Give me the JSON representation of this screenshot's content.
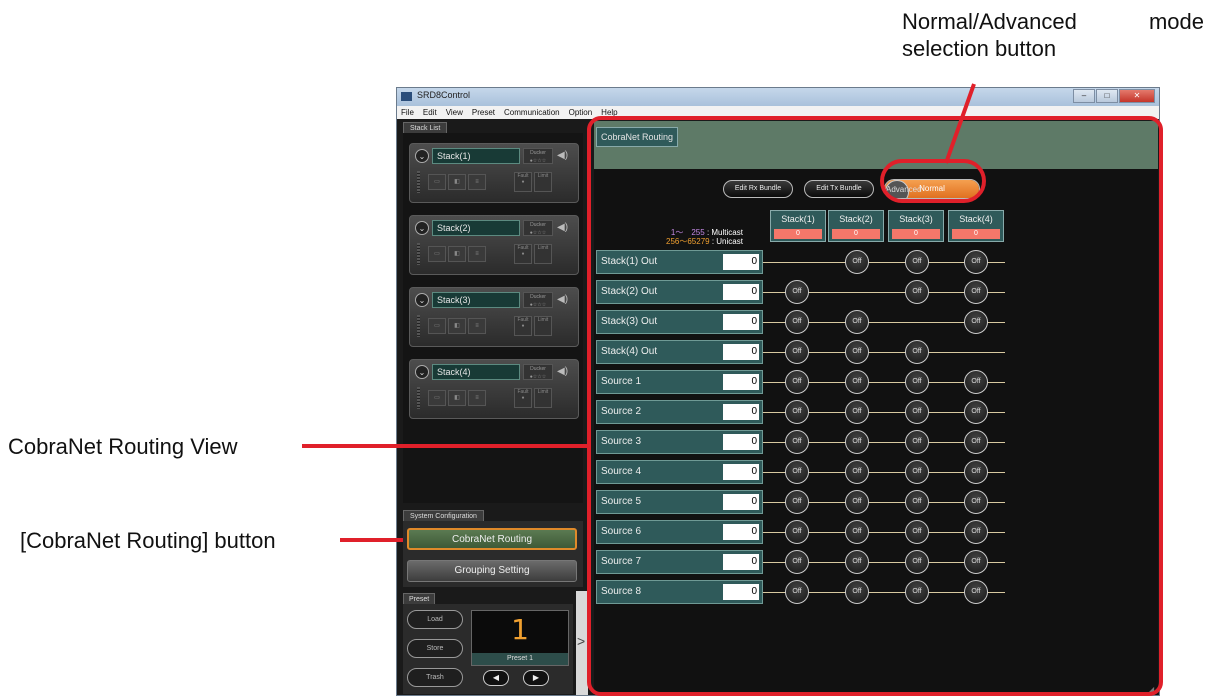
{
  "annotations": {
    "mode_button": [
      "Normal/Advanced mode",
      "selection button"
    ],
    "routing_view": "CobraNet Routing View",
    "routing_button": "[CobraNet Routing] button",
    "accent_color": "#e0202a"
  },
  "window": {
    "title": "SRD8Control",
    "menu": [
      "File",
      "Edit",
      "View",
      "Preset",
      "Communication",
      "Option",
      "Help"
    ]
  },
  "stack_list": {
    "tab": "Stack List",
    "stacks": [
      {
        "name": "Stack(1)",
        "ducker": "Ducker",
        "fault": "Fault",
        "limit": "Limit"
      },
      {
        "name": "Stack(2)",
        "ducker": "Ducker",
        "fault": "Fault",
        "limit": "Limit"
      },
      {
        "name": "Stack(3)",
        "ducker": "Ducker",
        "fault": "Fault",
        "limit": "Limit"
      },
      {
        "name": "Stack(4)",
        "ducker": "Ducker",
        "fault": "Fault",
        "limit": "Limit"
      }
    ]
  },
  "system": {
    "tab": "System Configuration",
    "cobranet_button": "CobraNet Routing",
    "grouping_button": "Grouping Setting"
  },
  "preset": {
    "tab": "Preset",
    "load": "Load",
    "store": "Store",
    "trash": "Trash",
    "number": "1",
    "name": "Preset 1",
    "prev": "◀",
    "next": "▶",
    "expand": ">"
  },
  "routing": {
    "tab": "CobraNet Routing",
    "edit_rx": "Edit Rx Bundle",
    "edit_tx": "Edit Tx Bundle",
    "mode": {
      "normal": "Normal",
      "advanced": "Advanced",
      "selected": "Normal"
    },
    "legend": {
      "multicast_range": "1～　255",
      "multicast_label": ": Multicast",
      "unicast_range": "256～65279",
      "unicast_label": ": Unicast"
    },
    "columns": [
      {
        "label": "Stack(1)",
        "value": "0"
      },
      {
        "label": "Stack(2)",
        "value": "0"
      },
      {
        "label": "Stack(3)",
        "value": "0"
      },
      {
        "label": "Stack(4)",
        "value": "0"
      }
    ],
    "off_label": "Off",
    "rows": [
      {
        "label": "Stack(1) Out",
        "value": "0",
        "cells": [
          false,
          true,
          true,
          true
        ]
      },
      {
        "label": "Stack(2) Out",
        "value": "0",
        "cells": [
          true,
          false,
          true,
          true
        ]
      },
      {
        "label": "Stack(3) Out",
        "value": "0",
        "cells": [
          true,
          true,
          false,
          true
        ]
      },
      {
        "label": "Stack(4) Out",
        "value": "0",
        "cells": [
          true,
          true,
          true,
          false
        ]
      },
      {
        "label": "Source 1",
        "value": "0",
        "cells": [
          true,
          true,
          true,
          true
        ]
      },
      {
        "label": "Source 2",
        "value": "0",
        "cells": [
          true,
          true,
          true,
          true
        ]
      },
      {
        "label": "Source 3",
        "value": "0",
        "cells": [
          true,
          true,
          true,
          true
        ]
      },
      {
        "label": "Source 4",
        "value": "0",
        "cells": [
          true,
          true,
          true,
          true
        ]
      },
      {
        "label": "Source 5",
        "value": "0",
        "cells": [
          true,
          true,
          true,
          true
        ]
      },
      {
        "label": "Source 6",
        "value": "0",
        "cells": [
          true,
          true,
          true,
          true
        ]
      },
      {
        "label": "Source 7",
        "value": "0",
        "cells": [
          true,
          true,
          true,
          true
        ]
      },
      {
        "label": "Source 8",
        "value": "0",
        "cells": [
          true,
          true,
          true,
          true
        ]
      }
    ]
  }
}
